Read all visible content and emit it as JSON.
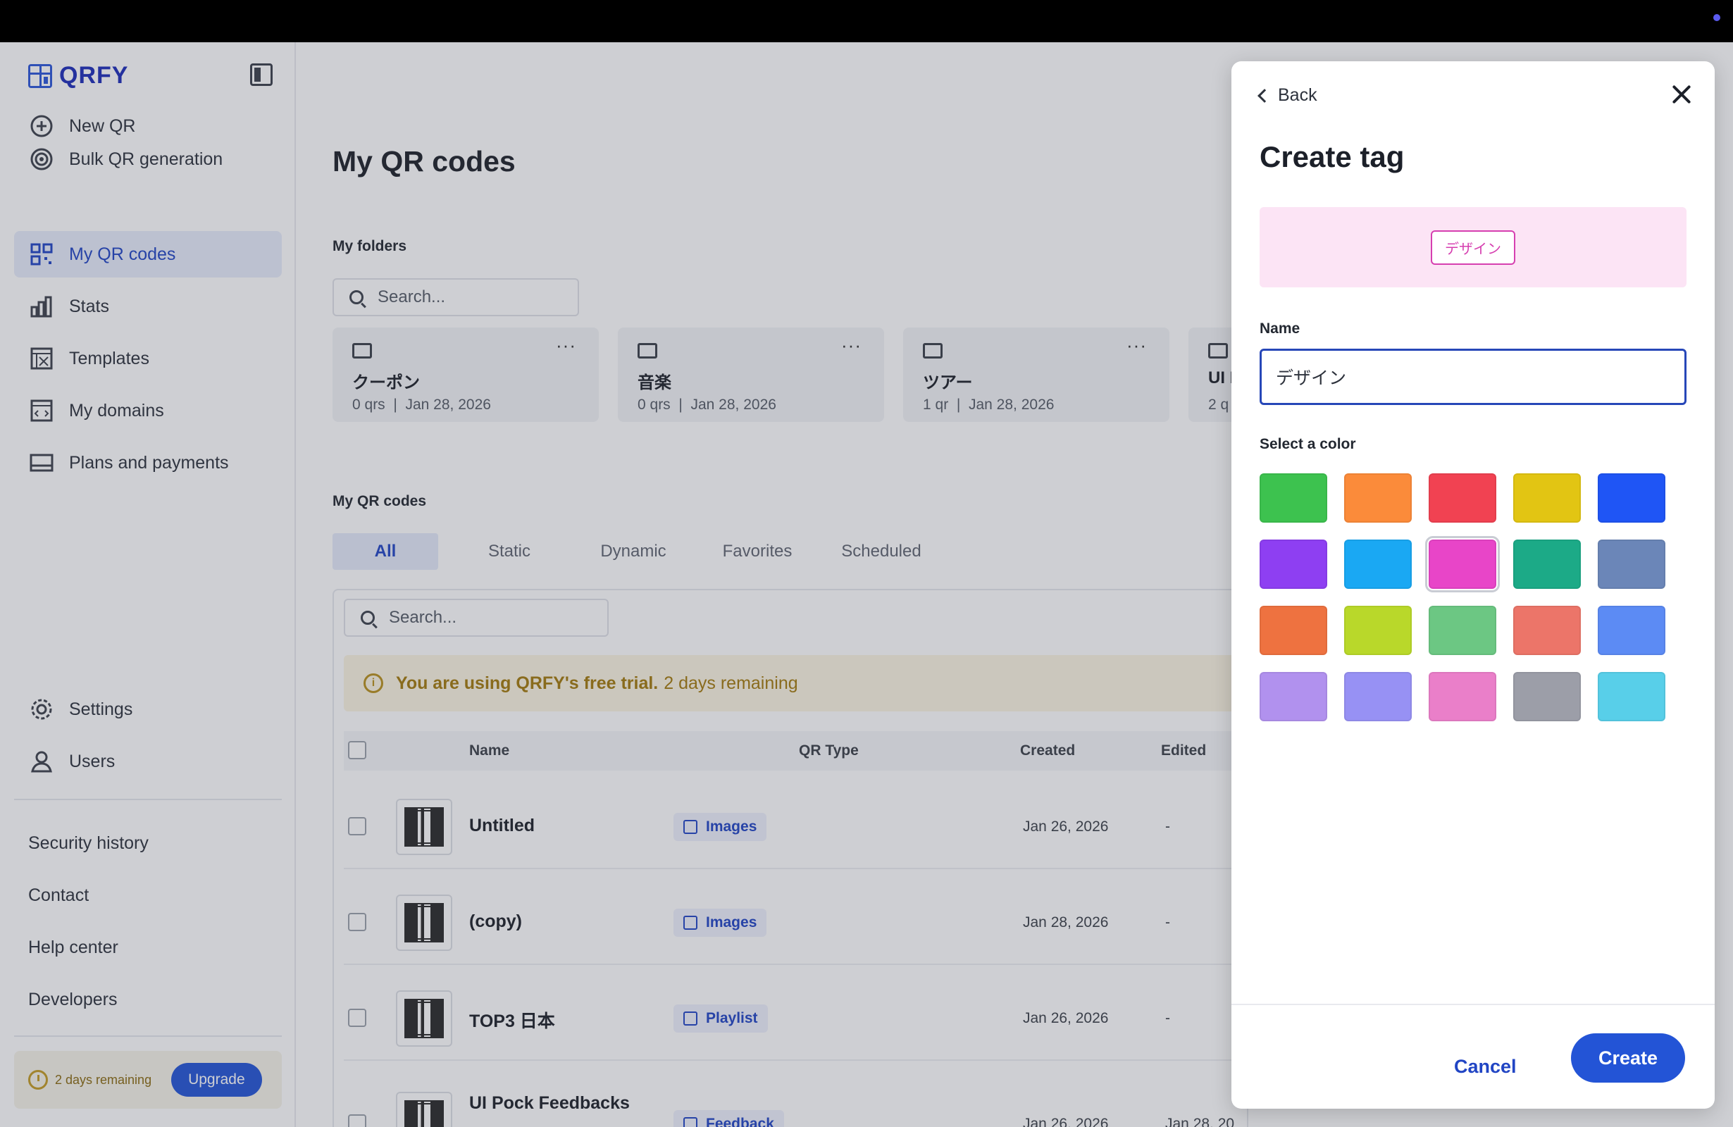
{
  "app": {
    "brand": "QRFY"
  },
  "sidebar": {
    "nav": [
      {
        "label": "New QR",
        "icon": "plus-circle-icon"
      },
      {
        "label": "Bulk QR generation",
        "icon": "target-icon"
      },
      {
        "label": "My QR codes",
        "icon": "qr-grid-icon",
        "active": true
      },
      {
        "label": "Stats",
        "icon": "bar-chart-icon"
      },
      {
        "label": "Templates",
        "icon": "template-icon"
      },
      {
        "label": "My domains",
        "icon": "domain-icon"
      },
      {
        "label": "Plans and payments",
        "icon": "card-icon"
      }
    ],
    "settings": "Settings",
    "users": "Users",
    "links": [
      "Security history",
      "Contact",
      "Help center",
      "Developers"
    ],
    "trial_text": "2 days remaining",
    "upgrade": "Upgrade"
  },
  "main": {
    "title": "My QR codes",
    "folders_label": "My folders",
    "folder_search_placeholder": "Search...",
    "folders": [
      {
        "name": "クーポン",
        "count": "0 qrs",
        "date": "Jan 28, 2026"
      },
      {
        "name": "音楽",
        "count": "0 qrs",
        "date": "Jan 28, 2026"
      },
      {
        "name": "ツアー",
        "count": "1 qr",
        "date": "Jan 28, 2026"
      },
      {
        "name": "UI I",
        "count": "2 q",
        "date": ""
      }
    ],
    "codes_label": "My QR codes",
    "tabs": [
      "All",
      "Static",
      "Dynamic",
      "Favorites",
      "Scheduled"
    ],
    "list_search_placeholder": "Search...",
    "banner_bold": "You are using QRFY's free trial.",
    "banner_rest": "2 days remaining",
    "columns": {
      "name": "Name",
      "type": "QR Type",
      "created": "Created",
      "edited": "Edited"
    },
    "rows": [
      {
        "name": "Untitled",
        "type": "Images",
        "created": "Jan 26, 2026",
        "edited": "-"
      },
      {
        "name": "(copy)",
        "type": "Images",
        "created": "Jan 28, 2026",
        "edited": "-"
      },
      {
        "name": "TOP3 日本",
        "type": "Playlist",
        "created": "Jan 26, 2026",
        "edited": "-"
      },
      {
        "name": "UI Pock Feedbacks",
        "type": "Feedback",
        "created": "Jan 26, 2026",
        "edited": "Jan 28, 20"
      }
    ]
  },
  "panel": {
    "back": "Back",
    "title": "Create tag",
    "preview_tag": "デザイン",
    "name_label": "Name",
    "name_value": "デザイン",
    "color_label": "Select a color",
    "colors": [
      "#3dc24f",
      "#fb8b3a",
      "#f14252",
      "#e2c513",
      "#1f55f5",
      "#8e3ff2",
      "#1aa8f3",
      "#e845c8",
      "#1caa87",
      "#6b86b8",
      "#ee7240",
      "#b9d82a",
      "#6cc783",
      "#ec7569",
      "#5c8bf4",
      "#b191ee",
      "#9791f4",
      "#ea7fc9",
      "#9c9ea8",
      "#58cfe9"
    ],
    "selected_color": "#e845c8",
    "cancel": "Cancel",
    "create": "Create"
  }
}
